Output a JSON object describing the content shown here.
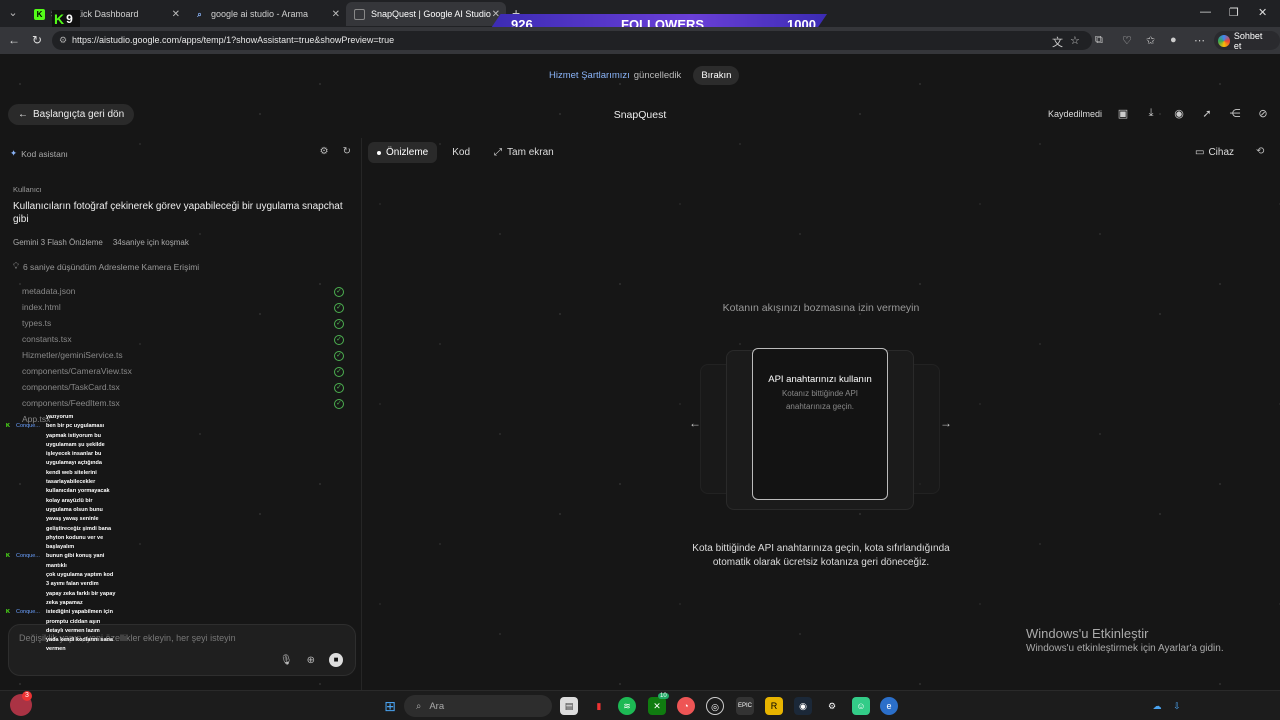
{
  "browser": {
    "tabs": [
      {
        "label": "S",
        "label2": "Kick Dashboard",
        "active": false
      },
      {
        "label": "google ai studio - Arama",
        "active": false
      },
      {
        "label": "SnapQuest | Google AI Studio",
        "active": true
      }
    ],
    "url": "https://aistudio.google.com/apps/temp/1?showAssistant=true&showPreview=true",
    "chat_button": "Sohbet et"
  },
  "overlay": {
    "count_current": "926",
    "label": "FOLLOWERS",
    "count_goal": "1000",
    "kick_badge": "9"
  },
  "banner": {
    "link": "Hizmet Şartlarımızı",
    "text": "güncelledik",
    "dismiss": "Bırakın"
  },
  "header": {
    "back": "Başlangıçta geri dön",
    "title": "SnapQuest",
    "status": "Kaydedilmedi"
  },
  "assistant": {
    "title": "Kod asistanı",
    "role": "Kullanıcı",
    "prompt": "Kullanıcıların fotoğraf çekinerek görev yapabileceği bir uygulama snapchat gibi",
    "model": "Gemini 3 Flash Önizleme",
    "runtime": "34saniye için koşmak",
    "thought": "6 saniye düşündüm Adresleme Kamera Erişimi",
    "files": [
      {
        "name": "metadata.json",
        "done": true
      },
      {
        "name": "index.html",
        "done": true
      },
      {
        "name": "types.ts",
        "done": true
      },
      {
        "name": "constants.tsx",
        "done": true
      },
      {
        "name": "Hizmetler/geminiService.ts",
        "done": true
      },
      {
        "name": "components/CameraView.tsx",
        "done": true
      },
      {
        "name": "components/TaskCard.tsx",
        "done": true
      },
      {
        "name": "components/FeedItem.tsx",
        "done": true
      },
      {
        "name": "App.tsx",
        "done": false
      }
    ],
    "input_placeholder": "Değişiklik yapın, yeni özellikler ekleyin, her şeyi isteyin"
  },
  "chat_overlay": [
    {
      "user": "",
      "msg": "yazıyorum"
    },
    {
      "user": "Conque...",
      "msg": "ben bir pc uygulaması"
    },
    {
      "user": "",
      "msg": "yapmak istiyorum bu"
    },
    {
      "user": "",
      "msg": "uygulamam şu şekilde"
    },
    {
      "user": "",
      "msg": "işleyecek insanlar bu"
    },
    {
      "user": "",
      "msg": "uygulamayı açtığında"
    },
    {
      "user": "",
      "msg": "kendi web sitelerini"
    },
    {
      "user": "",
      "msg": "tasarlayabilecekler"
    },
    {
      "user": "",
      "msg": "kullanıcıları yormayacak"
    },
    {
      "user": "",
      "msg": "kolay arayüzlü bir"
    },
    {
      "user": "",
      "msg": "uygulama olsun bunu"
    },
    {
      "user": "",
      "msg": "yavaş yavaş seninle"
    },
    {
      "user": "",
      "msg": "geliştireceğiz şimdi bana"
    },
    {
      "user": "",
      "msg": "phyton kodunu ver ve"
    },
    {
      "user": "",
      "msg": "başlayalım"
    },
    {
      "user": "Conque...",
      "msg": "bunun gibi konuş yani"
    },
    {
      "user": "",
      "msg": "mantıklı"
    },
    {
      "user": "",
      "msg": "çok uygulama yaptım kod"
    },
    {
      "user": "",
      "msg": "3 ayımı falan verdim"
    },
    {
      "user": "",
      "msg": "yapay zeka farklı bir yapay"
    },
    {
      "user": "",
      "msg": "zeka yapamaz"
    },
    {
      "user": "Conque...",
      "msg": "istediğini yapabilmen için"
    },
    {
      "user": "",
      "msg": "promptu ciddan aşırı"
    },
    {
      "user": "",
      "msg": "detaylı vermen lazım"
    },
    {
      "user": "",
      "msg": "yada kendi kodlarını sana"
    },
    {
      "user": "",
      "msg": "vermen"
    }
  ],
  "preview": {
    "tabs": [
      "Önizleme",
      "Kod",
      "Tam ekran"
    ],
    "device": "Cihaz",
    "subtitle": "Kotanın akışınızı bozmasına izin vermeyin",
    "card_title": "API anahtarınızı kullanın",
    "card_text": "Kotanız bittiğinde API anahtarınıza geçin.",
    "description": "Kota bittiğinde API anahtarınıza geçin, kota sıfırlandığında otomatik olarak ücretsiz kotanıza geri döneceğiz."
  },
  "watermark": {
    "line1": "Windows'u Etkinleştir",
    "line2": "Windows'u etkinleştirmek için Ayarlar'a gidin."
  },
  "taskbar": {
    "search": "Ara",
    "notify_count": "3",
    "xbox_badge": "10"
  }
}
